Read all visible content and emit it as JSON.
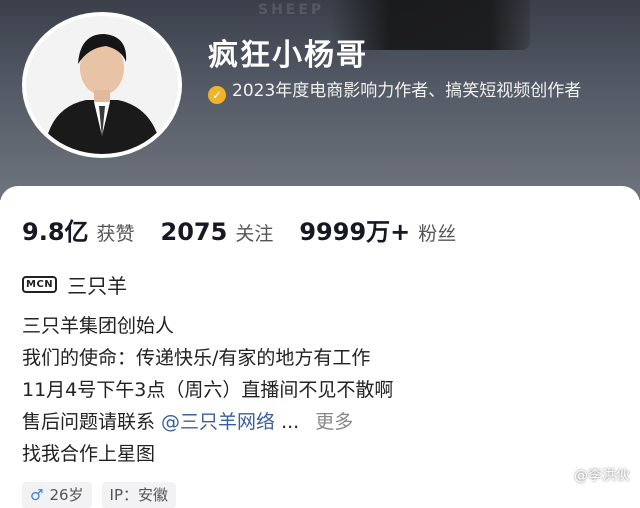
{
  "profile": {
    "name": "疯狂小杨哥",
    "verification": "2023年度电商影响力作者、搞笑短视频创作者"
  },
  "stats": [
    {
      "value": "9.8亿",
      "label": "获赞"
    },
    {
      "value": "2075",
      "label": "关注"
    },
    {
      "value": "9999万+",
      "label": "粉丝"
    }
  ],
  "mcn": {
    "badge": "MCN",
    "name": "三只羊"
  },
  "bio": {
    "line1": "三只羊集团创始人",
    "line2": "我们的使命：传递快乐/有家的地方有工作",
    "line3": "11月4号下午3点（周六）直播间不见不散啊",
    "line4_prefix": "售后问题请联系 ",
    "line4_link": "@三只羊网络",
    "line4_ellipsis": " ...",
    "more": "更多",
    "line5": "找我合作上星图"
  },
  "tags": {
    "age": "26岁",
    "ip": "IP：安徽"
  },
  "watermark": "@李洪伙",
  "colors": {
    "verify": "#f0b429",
    "link": "#3a5f9a",
    "gender": "#3b7fd6"
  },
  "icons": {
    "verify": "check-badge-icon",
    "gender": "male-icon"
  }
}
